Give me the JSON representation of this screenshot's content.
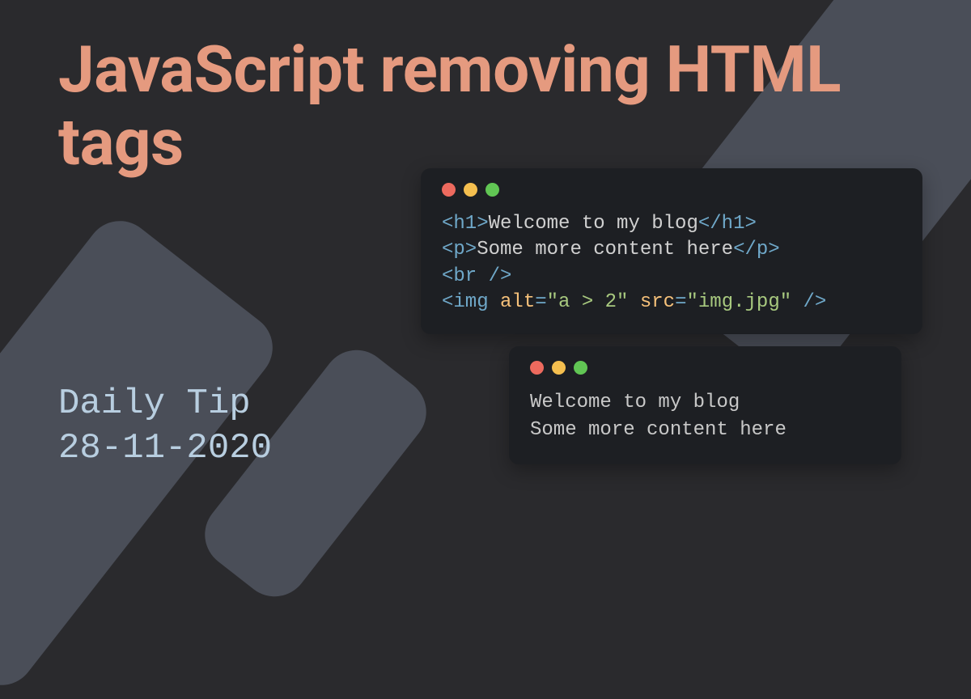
{
  "title": "JavaScript removing HTML tags",
  "subtitle_label": "Daily Tip",
  "subtitle_date": "28-11-2020",
  "code_window_1": {
    "lines": [
      {
        "segments": [
          {
            "class": "tag",
            "text": "<h1>"
          },
          {
            "class": "txt",
            "text": "Welcome to my blog"
          },
          {
            "class": "tag",
            "text": "</h1>"
          }
        ]
      },
      {
        "segments": [
          {
            "class": "tag",
            "text": "<p>"
          },
          {
            "class": "txt",
            "text": "Some more content here"
          },
          {
            "class": "tag",
            "text": "</p>"
          }
        ]
      },
      {
        "segments": [
          {
            "class": "tag",
            "text": "<br />"
          }
        ]
      },
      {
        "segments": [
          {
            "class": "tag",
            "text": "<img "
          },
          {
            "class": "attr",
            "text": "alt"
          },
          {
            "class": "tag",
            "text": "="
          },
          {
            "class": "str",
            "text": "\"a > 2\""
          },
          {
            "class": "tag",
            "text": " "
          },
          {
            "class": "attr",
            "text": "src"
          },
          {
            "class": "tag",
            "text": "="
          },
          {
            "class": "str",
            "text": "\"img.jpg\""
          },
          {
            "class": "tag",
            "text": " />"
          }
        ]
      }
    ]
  },
  "code_window_2": {
    "output": "Welcome to my blog\nSome more content here"
  }
}
